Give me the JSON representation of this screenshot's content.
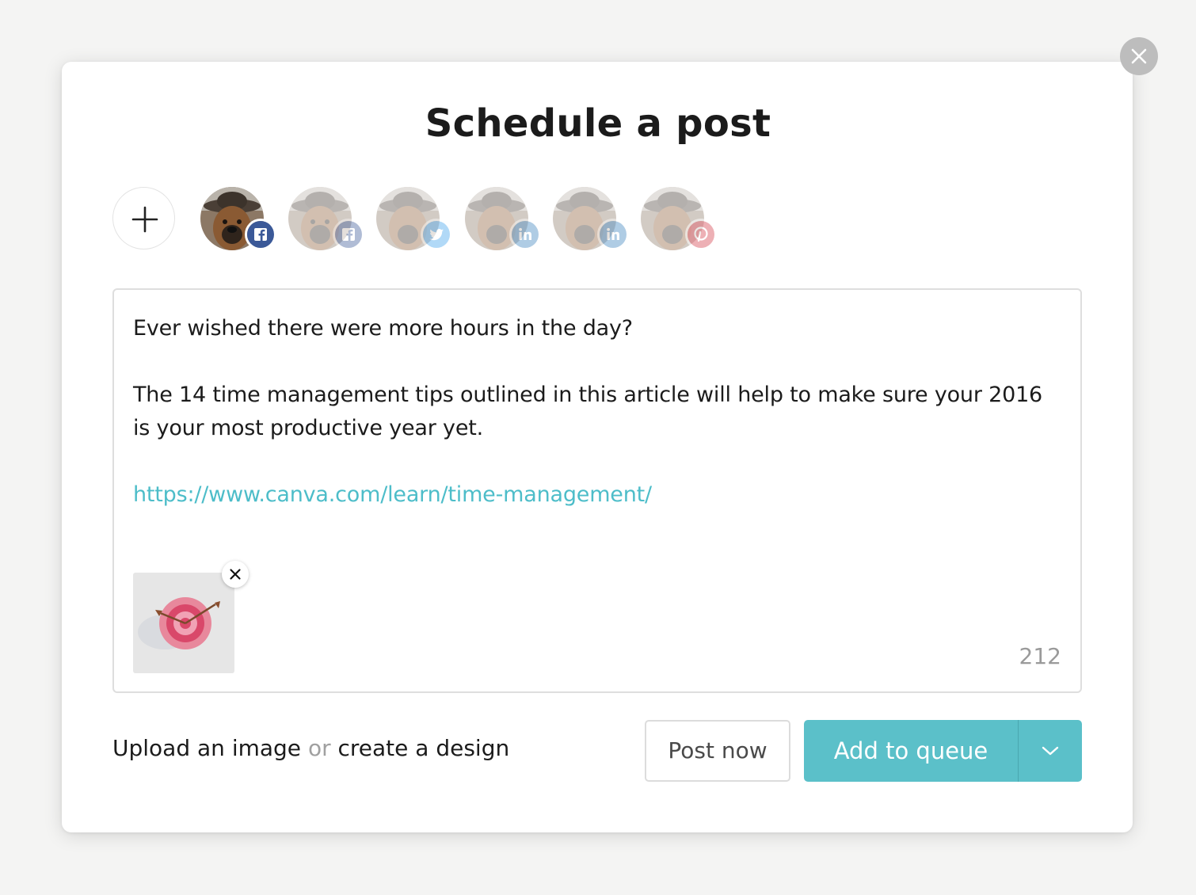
{
  "dialog": {
    "title": "Schedule a post"
  },
  "accounts": [
    {
      "network": "facebook",
      "selected": true,
      "icon": "facebook-icon",
      "color": "#3b5998"
    },
    {
      "network": "facebook",
      "selected": false,
      "icon": "facebook-icon",
      "color": "#3b5998"
    },
    {
      "network": "twitter",
      "selected": false,
      "icon": "twitter-icon",
      "color": "#55acee"
    },
    {
      "network": "linkedin",
      "selected": false,
      "icon": "linkedin-icon",
      "color": "#4f8fc4"
    },
    {
      "network": "linkedin",
      "selected": false,
      "icon": "linkedin-icon",
      "color": "#4f8fc4"
    },
    {
      "network": "pinterest",
      "selected": false,
      "icon": "pinterest-icon",
      "color": "#e0707a"
    }
  ],
  "composer": {
    "line1": "Ever wished there were more hours in the day?",
    "line2": "The 14 time management tips outlined in this article will help to make sure your 2016 is your most productive year yet.",
    "url": "https://www.canva.com/learn/time-management/",
    "char_count": "212"
  },
  "footer": {
    "upload_label": "Upload an image",
    "or_label": "or",
    "create_label": "create a design"
  },
  "actions": {
    "post_now": "Post now",
    "add_to_queue": "Add to queue"
  },
  "colors": {
    "accent": "#5bc0c9",
    "link": "#4dbdc9"
  }
}
